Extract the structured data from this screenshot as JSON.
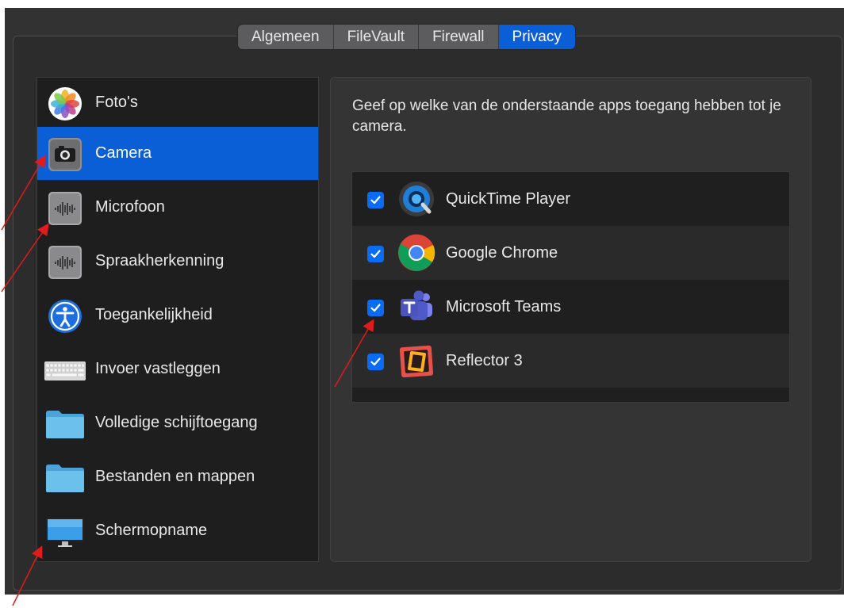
{
  "tabs": [
    {
      "label": "Algemeen",
      "active": false
    },
    {
      "label": "FileVault",
      "active": false
    },
    {
      "label": "Firewall",
      "active": false
    },
    {
      "label": "Privacy",
      "active": true
    }
  ],
  "privacy_categories": [
    {
      "label": "Foto's",
      "icon": "photos-icon",
      "selected": false
    },
    {
      "label": "Camera",
      "icon": "camera-icon",
      "selected": true
    },
    {
      "label": "Microfoon",
      "icon": "microphone-icon",
      "selected": false
    },
    {
      "label": "Spraakherkenning",
      "icon": "speech-recognition-icon",
      "selected": false
    },
    {
      "label": "Toegankelijkheid",
      "icon": "accessibility-icon",
      "selected": false
    },
    {
      "label": "Invoer vastleggen",
      "icon": "keyboard-icon",
      "selected": false
    },
    {
      "label": "Volledige schijftoegang",
      "icon": "folder-icon",
      "selected": false
    },
    {
      "label": "Bestanden en mappen",
      "icon": "folder-icon",
      "selected": false
    },
    {
      "label": "Schermopname",
      "icon": "display-icon",
      "selected": false
    }
  ],
  "camera_panel": {
    "description": "Geef op welke van de onderstaande apps toegang hebben tot je camera.",
    "apps": [
      {
        "name": "QuickTime Player",
        "checked": true,
        "icon": "quicktime-icon"
      },
      {
        "name": "Google Chrome",
        "checked": true,
        "icon": "chrome-icon"
      },
      {
        "name": "Microsoft Teams",
        "checked": true,
        "icon": "teams-icon"
      },
      {
        "name": "Reflector 3",
        "checked": true,
        "icon": "reflector-icon"
      }
    ]
  },
  "colors": {
    "accent": "#0a5fd6",
    "checkbox": "#0a6cf5",
    "annotation_arrow": "#e01b1b"
  }
}
